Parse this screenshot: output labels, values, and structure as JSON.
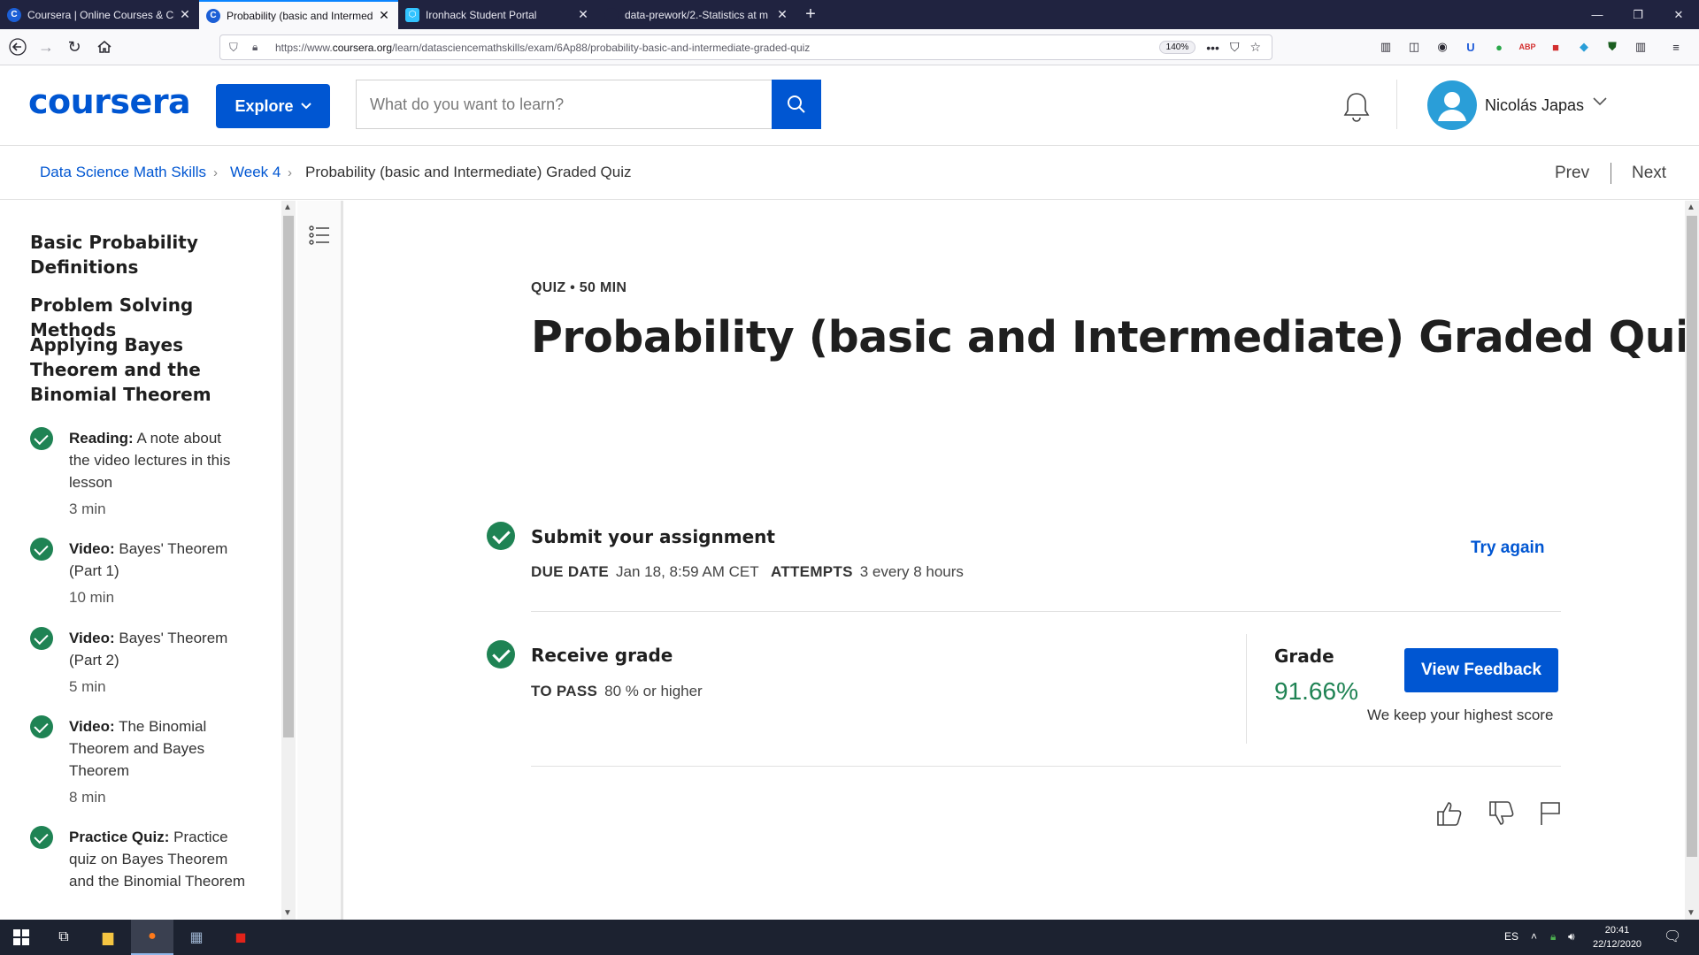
{
  "browser": {
    "tabs": [
      {
        "title": "Coursera | Online Courses & Cr",
        "favicon": "coursera-icon",
        "active": false
      },
      {
        "title": "Probability (basic and Intermed",
        "favicon": "coursera-icon",
        "active": true
      },
      {
        "title": "Ironhack Student Portal",
        "favicon": "ironhack-icon",
        "active": false
      },
      {
        "title": "data-prework/2.-Statistics at m",
        "favicon": "github-icon",
        "active": false
      }
    ],
    "url_prefix": "https://www.",
    "url_domain": "coursera.org",
    "url_path": "/learn/datasciencemathskills/exam/6Ap88/probability-basic-and-intermediate-graded-quiz",
    "zoom": "140%"
  },
  "header": {
    "logo": "coursera",
    "explore_label": "Explore",
    "search_placeholder": "What do you want to learn?",
    "user_name": "Nicolás Japas"
  },
  "breadcrumb": {
    "course": "Data Science Math Skills",
    "week": "Week 4",
    "current": "Probability (basic and Intermediate) Graded Quiz",
    "prev": "Prev",
    "next": "Next"
  },
  "sidebar": {
    "sections": [
      "Basic Probability Definitions",
      "Problem Solving Methods",
      "Applying Bayes Theorem and the Binomial Theorem"
    ],
    "items": [
      {
        "kind": "Reading:",
        "title": "A note about the video lectures in this lesson",
        "duration": "3 min"
      },
      {
        "kind": "Video:",
        "title": "Bayes' Theorem (Part 1)",
        "duration": "10 min"
      },
      {
        "kind": "Video:",
        "title": "Bayes' Theorem (Part 2)",
        "duration": "5 min"
      },
      {
        "kind": "Video:",
        "title": "The Binomial Theorem and Bayes Theorem",
        "duration": "8 min"
      },
      {
        "kind": "Practice Quiz:",
        "title": "Practice quiz on Bayes Theorem and the Binomial Theorem",
        "duration": ""
      }
    ]
  },
  "quiz": {
    "kicker": "QUIZ • 50 MIN",
    "title": "Probability (basic and Intermediate) Graded Quiz",
    "submit": {
      "heading": "Submit your assignment",
      "due_label": "DUE DATE",
      "due_value": "Jan 18, 8:59 AM CET",
      "attempts_label": "ATTEMPTS",
      "attempts_value": "3 every 8 hours",
      "try_again": "Try again"
    },
    "grade": {
      "heading": "Receive grade",
      "pass_label": "TO PASS",
      "pass_value": "80 % or higher",
      "grade_label": "Grade",
      "grade_value": "91.66%",
      "view_feedback": "View Feedback",
      "keep_note": "We keep your highest score"
    }
  },
  "taskbar": {
    "language": "ES",
    "time": "20:41",
    "date": "22/12/2020"
  },
  "colors": {
    "brand_blue": "#0056d2",
    "success_green": "#1f8354",
    "tabbar_bg": "#202340",
    "taskbar_bg": "#1c2230"
  }
}
